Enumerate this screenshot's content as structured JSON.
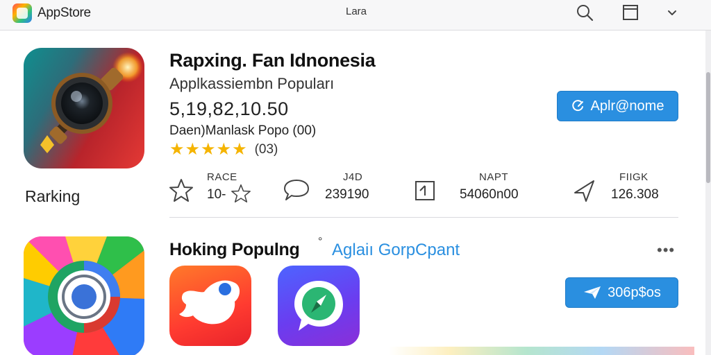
{
  "titlebar": {
    "brand": "AppStore",
    "window_title": "Lara",
    "icons": [
      "search-icon",
      "window-icon",
      "chevron-down-icon"
    ]
  },
  "featured": {
    "title": "Rapxing. Fan Idnonesia",
    "subtitle": "Applkassiembn Popuları",
    "price": "5,19,82,10.50",
    "developer": "Daen)Manlask Popo (00)",
    "rating_stars": 5,
    "rating_count": "(03)",
    "open_button": "Aplr@nome",
    "rank_label": "Rarking",
    "icon": "camera-lens-icon"
  },
  "stats": [
    {
      "head": "RACE",
      "value": "10-",
      "icon": "star-icon"
    },
    {
      "head": "J4D",
      "value": "239190",
      "icon": "chat-bubble-icon"
    },
    {
      "head": "NAPT",
      "value": "54060n00",
      "icon": "plus-box-icon"
    },
    {
      "head": "FIIGK",
      "value": "126.308",
      "icon": "navigation-arrow-icon"
    }
  ],
  "section": {
    "title": "Hoking Populng",
    "dot": "°",
    "link": "Aglaiı GorpCpant",
    "more": "•••",
    "button": "306p$os",
    "tiles": [
      "bird-app-icon",
      "compass-app-icon"
    ]
  },
  "colors": {
    "accent": "#2a8fe0",
    "star": "#f5b400",
    "tile_orange": "#ff4a2e",
    "tile_purple": "#5b49f0"
  }
}
